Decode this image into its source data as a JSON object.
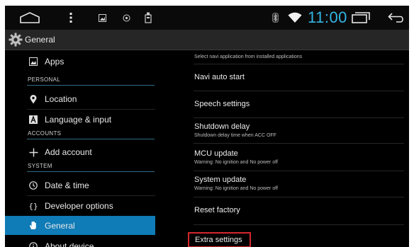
{
  "status_bar": {
    "icons": [
      "home-icon",
      "menu-icon",
      "gallery-icon",
      "media-icon",
      "usb-icon",
      "bluetooth-icon",
      "wifi-icon",
      "recent-apps-icon",
      "back-icon"
    ],
    "time": "11:00",
    "time_color": "#33b5e5"
  },
  "action_bar": {
    "icon": "settings-gear-icon",
    "title": "General"
  },
  "sidebar": {
    "selected_color": "#0f7bb7",
    "items": [
      {
        "label": "Apps",
        "icon": "apps-icon"
      },
      {
        "header": "PERSONAL"
      },
      {
        "label": "Location",
        "icon": "location-pin-icon"
      },
      {
        "label": "Language & input",
        "icon": "language-icon"
      },
      {
        "header": "ACCOUNTS"
      },
      {
        "label": "Add account",
        "icon": "plus-icon"
      },
      {
        "header": "SYSTEM"
      },
      {
        "label": "Date & time",
        "icon": "clock-icon"
      },
      {
        "label": "Developer options",
        "icon": "braces-icon"
      },
      {
        "label": "General",
        "icon": "hand-icon",
        "selected": true
      },
      {
        "label": "About device",
        "icon": "info-icon"
      }
    ]
  },
  "settings": {
    "items": [
      {
        "subtitle": "Select navi application from installed applications"
      },
      {
        "title": "Navi auto start"
      },
      {
        "title": "Speech settings"
      },
      {
        "title": "Shutdown delay",
        "subtitle": "Shutdown delay time when ACC OFF"
      },
      {
        "title": "MCU update",
        "subtitle": "Warning: No ignition and No power off"
      },
      {
        "title": "System update",
        "subtitle": "Warning: No ignition and No power off"
      },
      {
        "title": "Reset factory"
      },
      {
        "title": "Extra settings",
        "highlighted": true
      }
    ],
    "highlight_color": "#d4272e"
  }
}
